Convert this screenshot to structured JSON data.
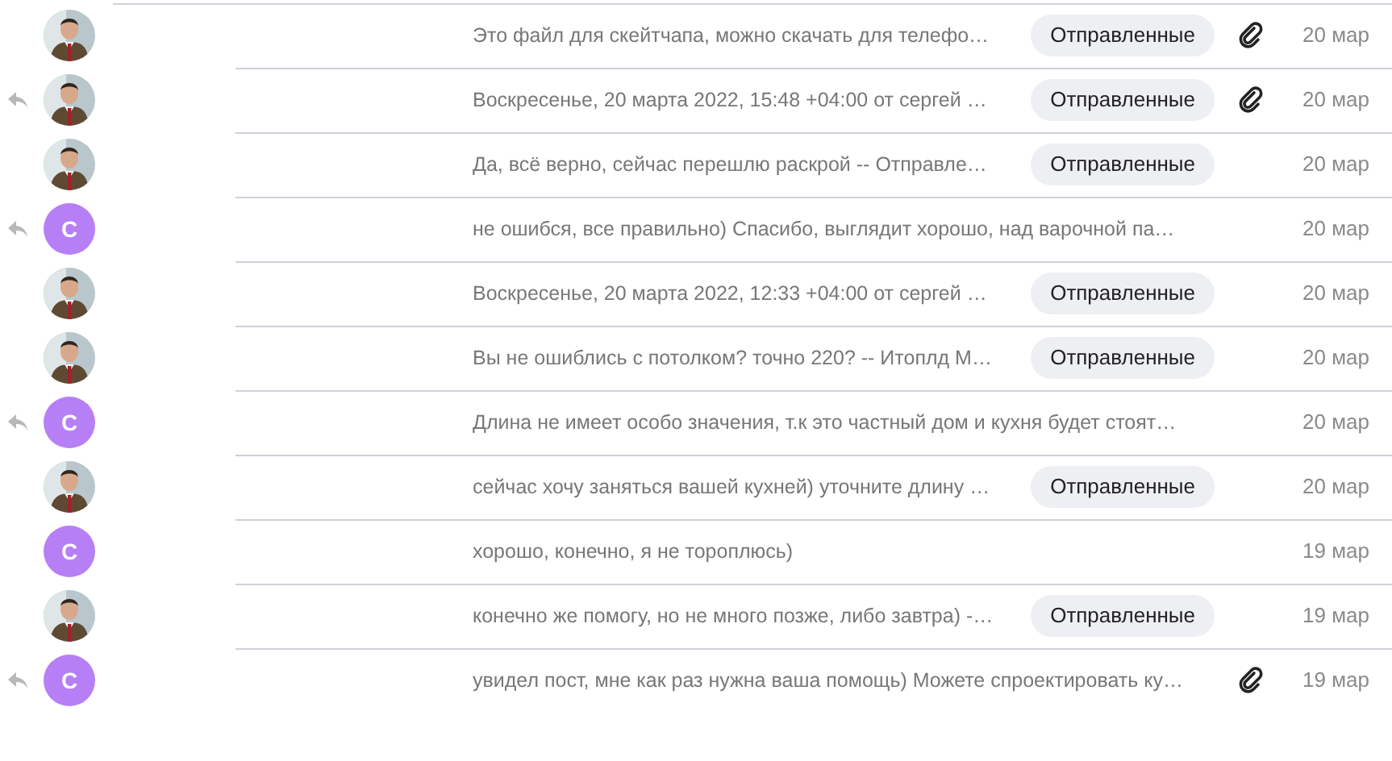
{
  "messages": [
    {
      "replied": false,
      "snippet": "Это файл для скейтчапа, можно скачать для телефо…",
      "folder": "Отправленные",
      "attachment": true,
      "date": "20 мар"
    },
    {
      "replied": true,
      "snippet": "Воскресенье, 20 марта 2022, 15:48 +04:00 от сергей …",
      "folder": "Отправленные",
      "attachment": true,
      "date": "20 мар"
    },
    {
      "replied": false,
      "snippet": "Да, всё верно, сейчас перешлю раскрой -- Отправле…",
      "folder": "Отправленные",
      "attachment": false,
      "date": "20 мар"
    },
    {
      "replied": true,
      "avatar": {
        "kind": "letter",
        "letter": "С",
        "color": "#b77ff6"
      },
      "snippet": "не ошибся, все правильно) Спасибо, выглядит хорошо, над варочной па…",
      "attachment": false,
      "date": "20 мар"
    },
    {
      "replied": false,
      "snippet": "Воскресенье, 20 марта 2022, 12:33 +04:00 от сергей …",
      "folder": "Отправленные",
      "attachment": false,
      "date": "20 мар"
    },
    {
      "replied": false,
      "snippet": "Вы не ошиблись с потолком? точно 220? -- Итоплд М…",
      "folder": "Отправленные",
      "attachment": false,
      "date": "20 мар"
    },
    {
      "replied": true,
      "avatar": {
        "kind": "letter",
        "letter": "С",
        "color": "#b77ff6"
      },
      "snippet": "Длина не имеет особо значения, т.к это частный дом и кухня будет стоят…",
      "attachment": false,
      "date": "20 мар"
    },
    {
      "replied": false,
      "snippet": "сейчас хочу заняться вашей кухней) уточните длину …",
      "folder": "Отправленные",
      "attachment": false,
      "date": "20 мар"
    },
    {
      "replied": false,
      "avatar": {
        "kind": "letter",
        "letter": "С",
        "color": "#b77ff6"
      },
      "snippet": "хорошо, конечно, я не тороплюсь)",
      "attachment": false,
      "date": "19 мар"
    },
    {
      "replied": false,
      "snippet": "конечно же помогу, но не много позже, либо завтра) -…",
      "folder": "Отправленные",
      "attachment": false,
      "date": "19 мар"
    },
    {
      "replied": true,
      "avatar": {
        "kind": "letter",
        "letter": "С",
        "color": "#b77ff6"
      },
      "snippet": "увидел пост, мне как раз нужна ваша помощь) Можете спроектировать ку…",
      "attachment": true,
      "date": "19 мар"
    }
  ]
}
